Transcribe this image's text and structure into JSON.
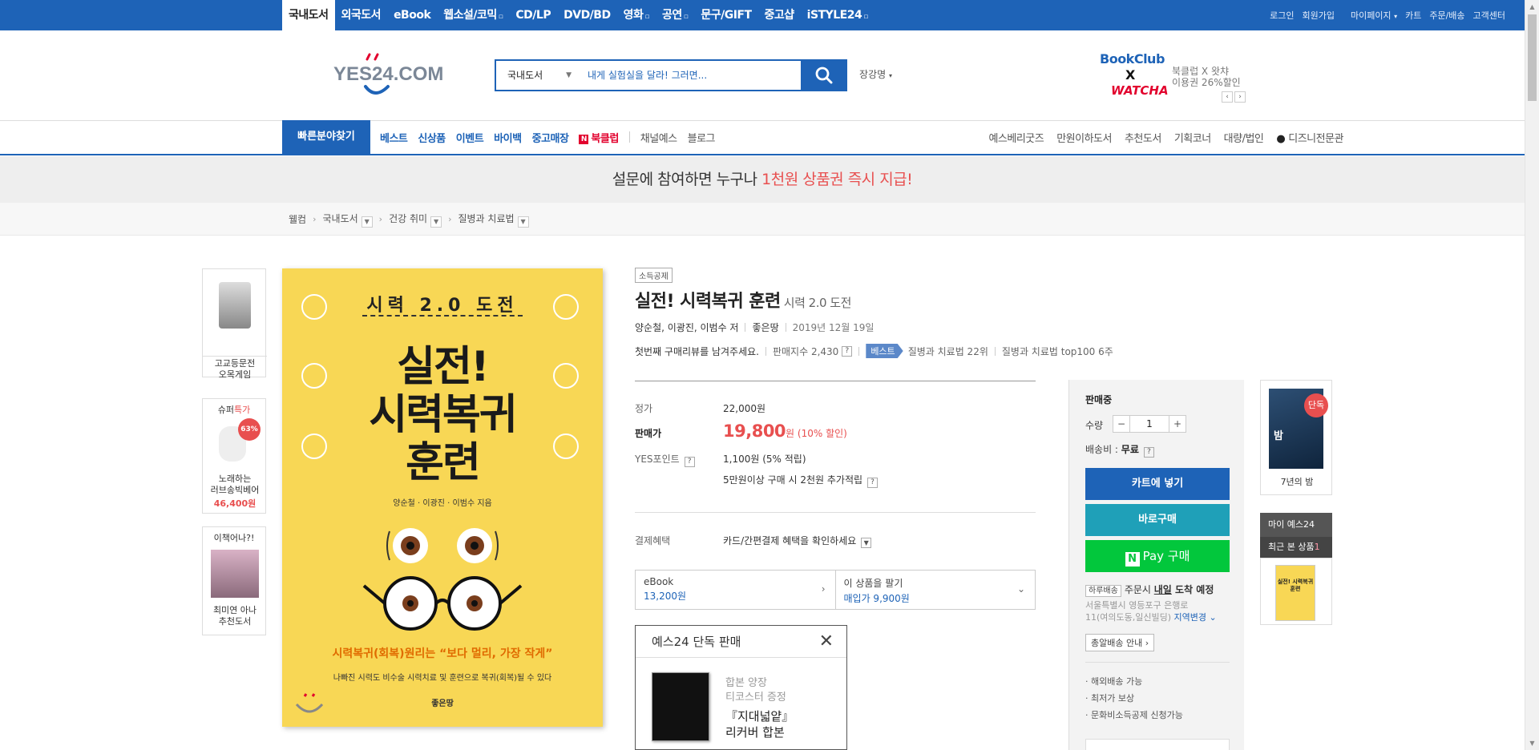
{
  "topbar": {
    "categories": [
      "국내도서",
      "외국도서",
      "eBook",
      "웹소설/코믹",
      "CD/LP",
      "DVD/BD",
      "영화",
      "공연",
      "문구/GIFT",
      "중고샵",
      "iSTYLE24"
    ],
    "util": [
      "로그인",
      "회원가입",
      "마이페이지",
      "카트",
      "주문/배송",
      "고객센터"
    ]
  },
  "header": {
    "logo_text": "YES24.COM",
    "search_category": "국내도서",
    "search_query": "내게 실험실을 달라! 그러면...",
    "extra_link": "장강명",
    "bookclub": {
      "title": "BookClub",
      "x": "X",
      "partner": "WATCHA",
      "desc1": "북클럽 X 왓챠",
      "desc2": "이용권 26%할인"
    }
  },
  "nav": {
    "quick": "빠른분야찾기",
    "links": [
      "베스트",
      "신상품",
      "이벤트",
      "바이백",
      "중고매장",
      "북클럽"
    ],
    "links_gray": [
      "채널예스",
      "블로그"
    ],
    "right": [
      "예스베리굿즈",
      "만원이하도서",
      "추천도서",
      "기획코너",
      "대량/법인",
      "디즈니전문관"
    ]
  },
  "banner": {
    "pre": "설문에 참여하면 누구나 ",
    "highlight": "1천원 상품권 즉시 지급!"
  },
  "breadcrumb": [
    "웰컴",
    "국내도서",
    "건강 취미",
    "질병과 치료법"
  ],
  "side_ads": [
    {
      "caption1": "고교등문전",
      "caption2": "오목게임"
    },
    {
      "title_pre": "슈퍼",
      "title_hl": "특가",
      "discount": "63%",
      "caption1": "노래하는",
      "caption2": "러브송빅베어",
      "price": "46,400원"
    },
    {
      "title": "이책어나?!",
      "caption1": "최미연 아나",
      "caption2": "추천도서"
    }
  ],
  "cover": {
    "top": "시력 2.0 도전",
    "title_lines": [
      "실전!",
      "시력복귀",
      "훈련"
    ],
    "authors": "양순철 · 이광진 · 이범수 지음",
    "tagline": "시력복귀(회복)원리는 “보다 멀리, 가장 작게”",
    "subtitle": "나빠진 시력도 비수술 시력치료 및 훈련으로 복귀(회복)될 수 있다",
    "publisher": "좋은땅"
  },
  "product": {
    "tag": "소득공제",
    "title": "실전! 시력복귀 훈련",
    "subtitle": "시력 2.0 도전",
    "authors": "양순철, 이광진, 이범수 저",
    "publisher": "좋은땅",
    "date": "2019년 12월 19일",
    "review_prompt": "첫번째 구매리뷰를 남겨주세요.",
    "sales_index": "판매지수 2,430",
    "best_label": "베스트",
    "rank1": "질병과 치료법 22위",
    "rank2": "질병과 치료법 top100 6주"
  },
  "pricing": {
    "list_label": "정가",
    "list_price": "22,000원",
    "sale_label": "판매가",
    "sale_price": "19,800",
    "sale_unit": "원",
    "discount": "(10% 할인)",
    "points_label": "YES포인트",
    "points": "1,100원 (5% 적립)",
    "points_extra": "5만원이상 구매 시 2천원 추가적립",
    "pay_label": "결제혜택",
    "pay_benefit": "카드/간편결제 혜택을 확인하세요"
  },
  "formats": {
    "ebook_label": "eBook",
    "ebook_price": "13,200원",
    "sell_label": "이 상품을 팔기",
    "sell_price": "매입가 9,900원"
  },
  "exclusive": {
    "header": "예스24 단독 판매",
    "gift1": "합본 양장",
    "gift2": "티코스터 증정",
    "gift3": "『지대넓얕』",
    "gift4": "리커버 합본"
  },
  "buy": {
    "status": "판매중",
    "qty_label": "수량",
    "qty": "1",
    "ship_label": "배송비 : ",
    "ship_value": "무료",
    "cart": "카트에 넣기",
    "buy_now": "바로구매",
    "npay": "Pay 구매",
    "day_badge": "하루배송",
    "day_pre": "주문시 ",
    "day_when": "내일",
    "day_post": " 도착 예정",
    "addr1": "서울특별시 영등포구 은행로",
    "addr2": "11(여의도동,일신빌딩) ",
    "addr_change": "지역변경",
    "guide": "총알배송 안내",
    "features": [
      "해외배송 가능",
      "최저가 보상",
      "문화비소득공제 신청가능"
    ]
  },
  "right_col": {
    "badge": "단독",
    "book": "밤",
    "caption": "7년의 밤",
    "my24": "마이 예스24",
    "recent": "최근 본 상품",
    "recent_count": "1",
    "recent_thumb": "실전! 시력복귀 훈련"
  },
  "colors": {
    "brand": "#1e63b7",
    "sale": "#e84f4f",
    "npay": "#02c73c",
    "buy_now": "#1fa0b8"
  }
}
